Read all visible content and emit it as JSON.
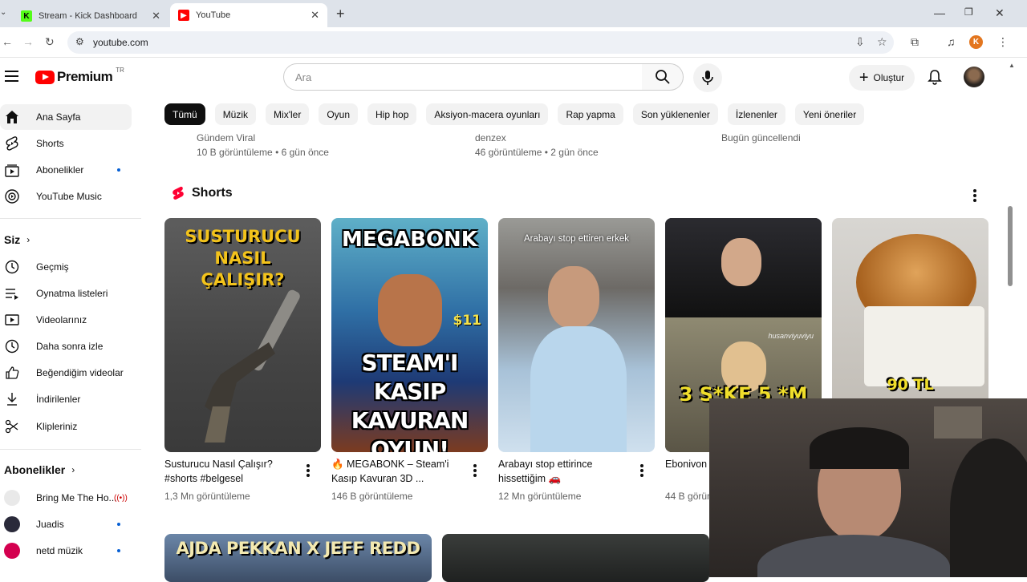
{
  "browser": {
    "tabs": [
      {
        "title": "Stream - Kick Dashboard",
        "favicon": "K"
      },
      {
        "title": "YouTube"
      }
    ],
    "url": "youtube.com",
    "profile_initial": "K"
  },
  "header": {
    "brand": "Premium",
    "country": "TR",
    "search_placeholder": "Ara",
    "create_label": "Oluştur"
  },
  "sidebar": {
    "main": [
      {
        "label": "Ana Sayfa"
      },
      {
        "label": "Shorts"
      },
      {
        "label": "Abonelikler"
      },
      {
        "label": "YouTube Music"
      }
    ],
    "you_title": "Siz",
    "you": [
      {
        "label": "Geçmiş"
      },
      {
        "label": "Oynatma listeleri"
      },
      {
        "label": "Videolarınız"
      },
      {
        "label": "Daha sonra izle"
      },
      {
        "label": "Beğendiğim videolar"
      },
      {
        "label": "İndirilenler"
      },
      {
        "label": "Klipleriniz"
      }
    ],
    "subs_title": "Abonelikler",
    "subs": [
      {
        "label": "Bring Me The Ho..."
      },
      {
        "label": "Juadis"
      },
      {
        "label": "netd müzik"
      }
    ]
  },
  "chips": [
    "Tümü",
    "Müzik",
    "Mix'ler",
    "Oyun",
    "Hip hop",
    "Aksiyon-macera oyunları",
    "Rap yapma",
    "Son yüklenenler",
    "İzlenenler",
    "Yeni öneriler"
  ],
  "prev_row": [
    {
      "channel": "Gündem Viral",
      "stats": "10 B görüntüleme • 6 gün önce"
    },
    {
      "channel": "denzex",
      "stats": "46 görüntüleme • 2 gün önce"
    },
    {
      "channel": "Bugün güncellendi",
      "stats": ""
    }
  ],
  "shorts": {
    "title": "Shorts",
    "items": [
      {
        "title": "Susturucu Nasıl Çalışır? #shorts #belgesel",
        "views": "1,3 Mn görüntüleme",
        "thumb_lines": [
          "SUSTURUCU",
          "NASIL",
          "ÇALIŞIR?"
        ]
      },
      {
        "title": "🔥 MEGABONK – Steam'i Kasıp Kavuran 3D ...",
        "views": "146 B görüntüleme",
        "thumb_top": "MEGABONK",
        "thumb_lines": [
          "STEAM'I",
          "KASIP KAVURAN",
          "OYUN!"
        ],
        "thumb_badge": "$11"
      },
      {
        "title": "Arabayı stop ettirince hissettiğim 🚗",
        "views": "12 Mn görüntüleme",
        "thumb_caption": "Arabayı stop ettiren erkek"
      },
      {
        "title": "Ebonivon ... İzliyor",
        "views": "44 B görüntüleme",
        "thumb_lines": [
          "3 S*KE 5 *M"
        ],
        "thumb_tag": "husanviyuviyu"
      },
      {
        "title": "",
        "views": "",
        "thumb_lines": [
          "90 TL"
        ]
      }
    ]
  },
  "videos": [
    {
      "thumb_text": "AJDA PEKKAN X JEFF REDD"
    }
  ]
}
